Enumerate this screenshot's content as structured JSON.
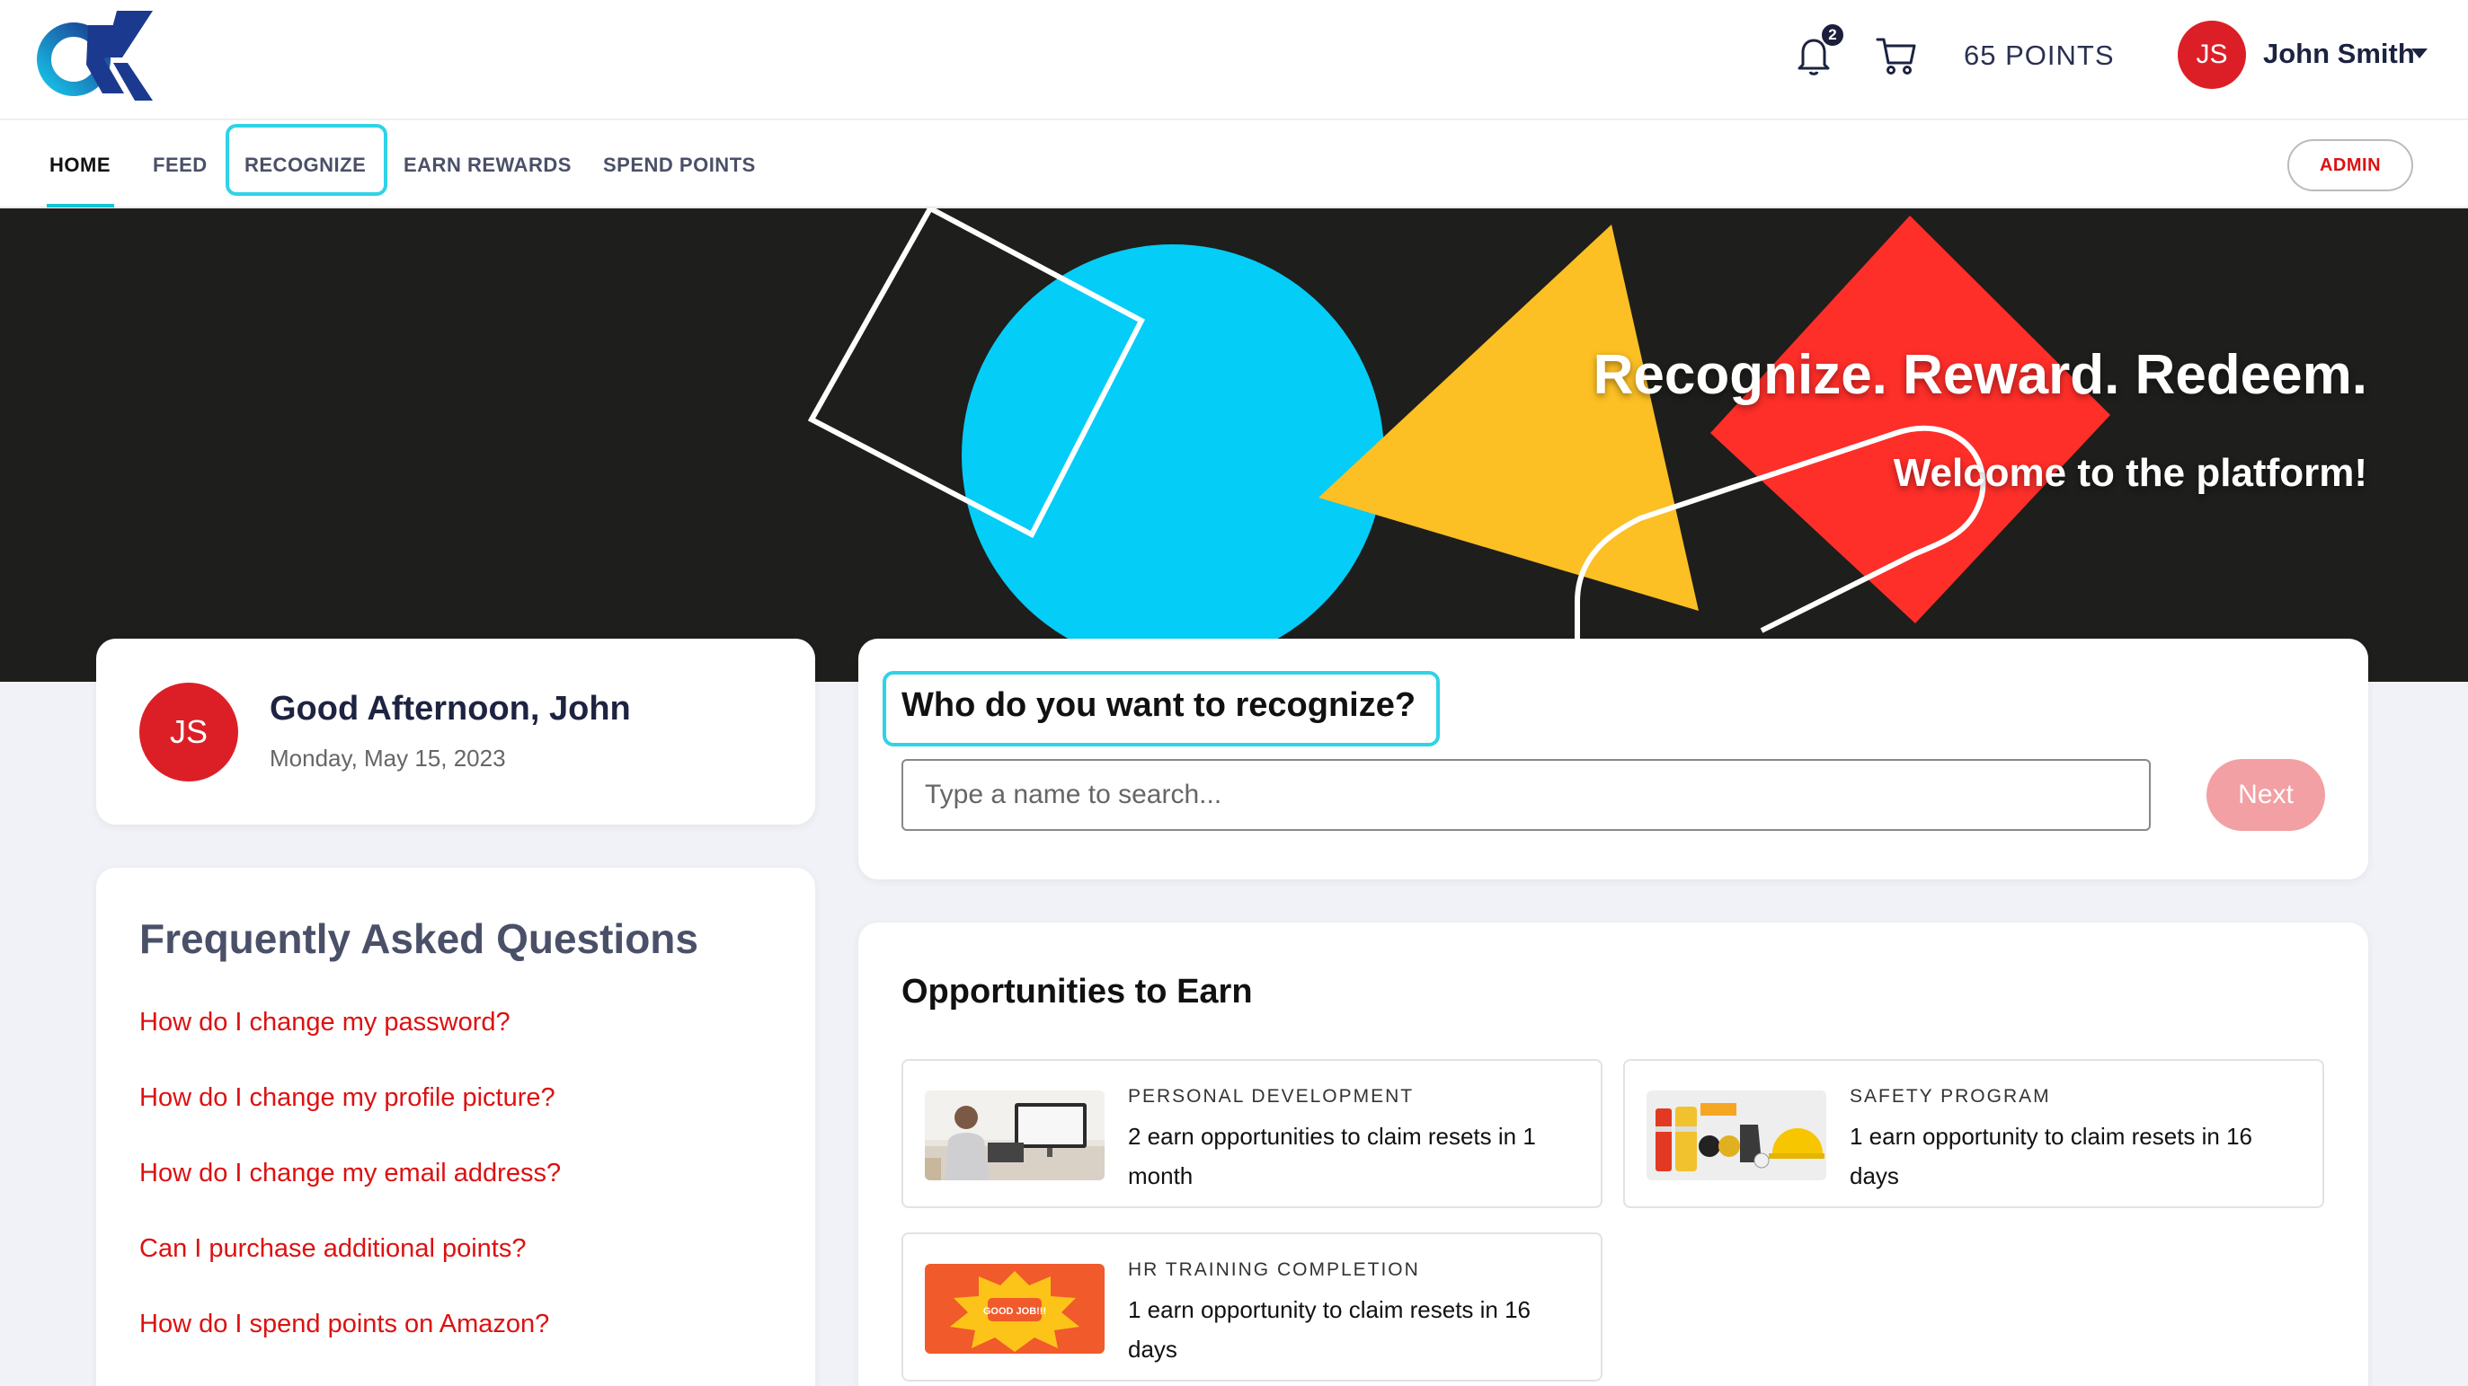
{
  "header": {
    "notification_count": "2",
    "points_label": "65 POINTS",
    "user_initials": "JS",
    "user_name": "John Smith"
  },
  "nav": {
    "items": [
      "HOME",
      "FEED",
      "RECOGNIZE",
      "EARN REWARDS",
      "SPEND POINTS"
    ],
    "active": "HOME",
    "admin_label": "ADMIN"
  },
  "hero": {
    "title": "Recognize. Reward. Redeem.",
    "subtitle": "Welcome to the platform!"
  },
  "greeting": {
    "initials": "JS",
    "title": "Good Afternoon, John",
    "date": "Monday, May 15, 2023"
  },
  "recognize": {
    "question": "Who do you want to recognize?",
    "placeholder": "Type a name to search...",
    "next_label": "Next"
  },
  "faq": {
    "title": "Frequently Asked Questions",
    "items": [
      "How do I change my password?",
      "How do I change my profile picture?",
      "How do I change my email address?",
      "Can I purchase additional points?",
      "How do I spend points on Amazon?"
    ]
  },
  "opportunities": {
    "title": "Opportunities to Earn",
    "items": [
      {
        "category": "PERSONAL DEVELOPMENT",
        "description": "2 earn opportunities to claim resets in 1 month"
      },
      {
        "category": "SAFETY PROGRAM",
        "description": "1 earn opportunity to claim resets in 16 days"
      },
      {
        "category": "HR TRAINING COMPLETION",
        "description": "1 earn opportunity to claim resets in 16 days"
      }
    ],
    "thumb_badge_text": "GOOD JOB!!!"
  },
  "colors": {
    "brand_red": "#dc1f26",
    "accent_cyan": "#2fd3e6",
    "hero_bg": "#1e1e1c",
    "shape_blue": "#04cdf7",
    "shape_yellow": "#fcbf24",
    "shape_red": "#fe2e29"
  }
}
